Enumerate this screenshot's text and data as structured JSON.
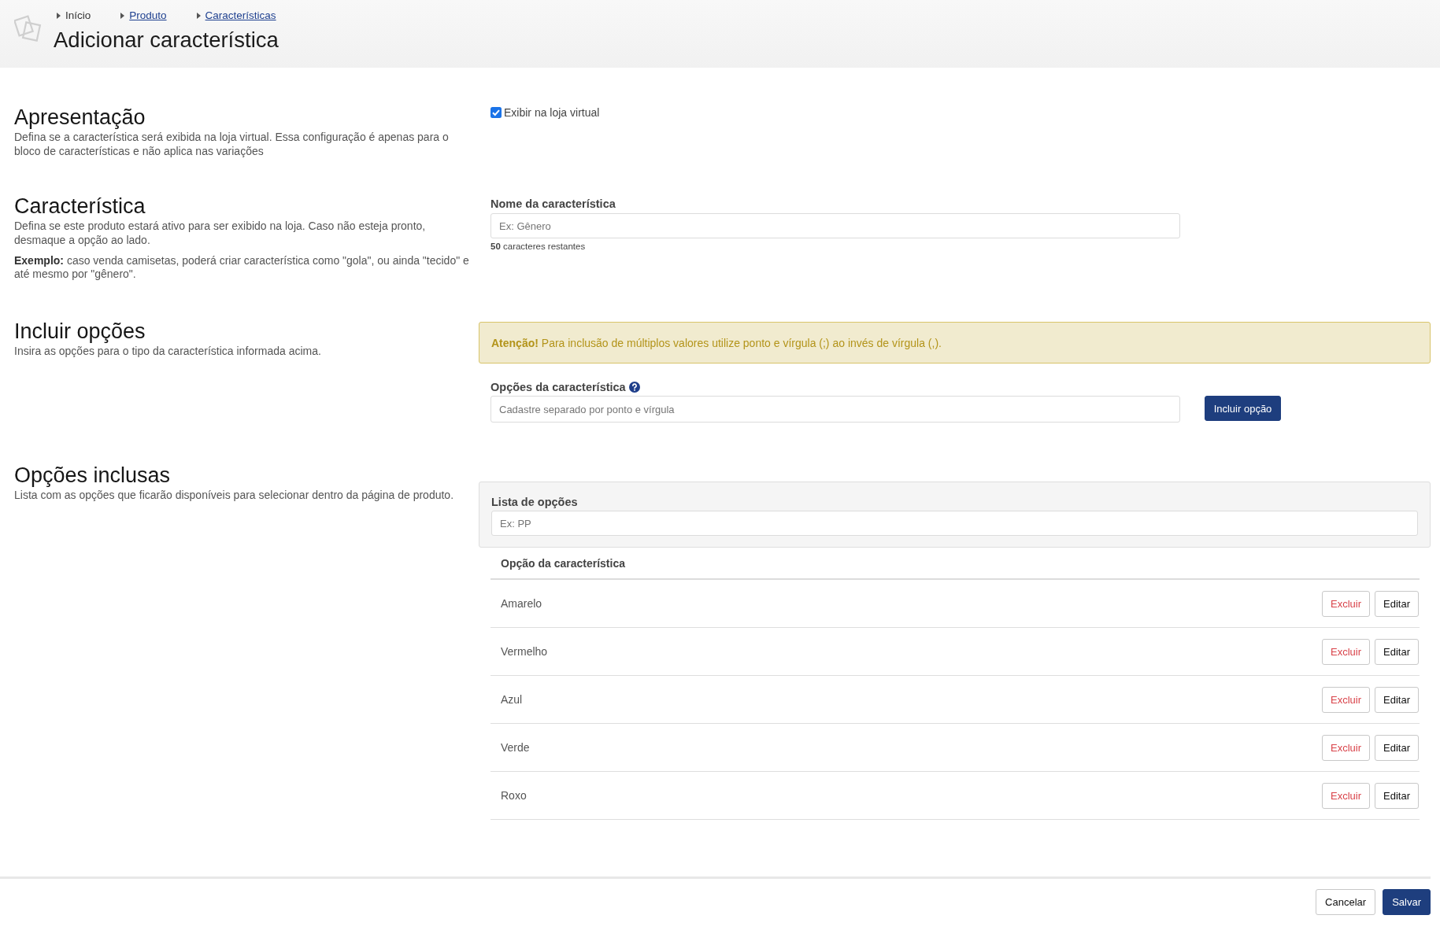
{
  "header": {
    "breadcrumbs": [
      {
        "label": "Início",
        "kind": "text"
      },
      {
        "label": "Produto",
        "kind": "link"
      },
      {
        "label": "Características",
        "kind": "link"
      }
    ],
    "title": "Adicionar característica"
  },
  "presentation": {
    "title": "Apresentação",
    "description": [
      "Defina se a característica será exibida na loja virtual. Essa configuração é apenas para o bloco de características e não aplica nas variações"
    ],
    "show_in_store": {
      "label": "Exibir na loja virtual",
      "checked": true
    }
  },
  "characteristic": {
    "title": "Característica",
    "description": [
      "Defina se este produto estará ativo para ser exibido na loja. Caso não esteja pronto, desmaque a opção ao lado.",
      "**Exemplo:** caso venda camisetas, poderá criar característica como \"gola\", ou ainda \"tecido\" e até mesmo por \"gênero\"."
    ],
    "name_field": {
      "label": "Nome da característica",
      "placeholder": "Ex: Gênero",
      "counter": "**50** caracteres restantes"
    }
  },
  "include_options": {
    "title": "Incluir opções",
    "description": [
      "Insira as opções para o tipo da característica informada acima."
    ],
    "alert": "**Atenção!** Para inclusão de múltiplos valores utilize ponto e vírgula (;) ao invés de vírgula (,).",
    "options_field": {
      "label": "Opções da característica",
      "placeholder": "Cadastre separado por ponto e vírgula"
    },
    "add_button": "Incluir opção"
  },
  "included_options": {
    "title": "Opções inclusas",
    "description": [
      "Lista com as opções que ficarão disponíveis para selecionar dentro da página de produto."
    ],
    "list_field": {
      "label": "Lista de opções",
      "placeholder": "Ex: PP"
    },
    "table": {
      "columns": [
        "Opção da característica"
      ],
      "rows": [
        {
          "name": "Amarelo",
          "actions": [
            {
              "label": "Excluir",
              "kind": "danger"
            },
            {
              "label": "Editar",
              "kind": "default"
            }
          ]
        },
        {
          "name": "Vermelho",
          "actions": [
            {
              "label": "Excluir",
              "kind": "danger"
            },
            {
              "label": "Editar",
              "kind": "default"
            }
          ]
        },
        {
          "name": "Azul",
          "actions": [
            {
              "label": "Excluir",
              "kind": "danger"
            },
            {
              "label": "Editar",
              "kind": "default"
            }
          ]
        },
        {
          "name": "Verde",
          "actions": [
            {
              "label": "Excluir",
              "kind": "danger"
            },
            {
              "label": "Editar",
              "kind": "default"
            }
          ]
        },
        {
          "name": "Roxo",
          "actions": [
            {
              "label": "Excluir",
              "kind": "danger"
            },
            {
              "label": "Editar",
              "kind": "default"
            }
          ]
        }
      ]
    }
  },
  "footer": {
    "buttons": [
      {
        "label": "Cancelar",
        "kind": "default"
      },
      {
        "label": "Salvar",
        "kind": "primary"
      }
    ]
  }
}
